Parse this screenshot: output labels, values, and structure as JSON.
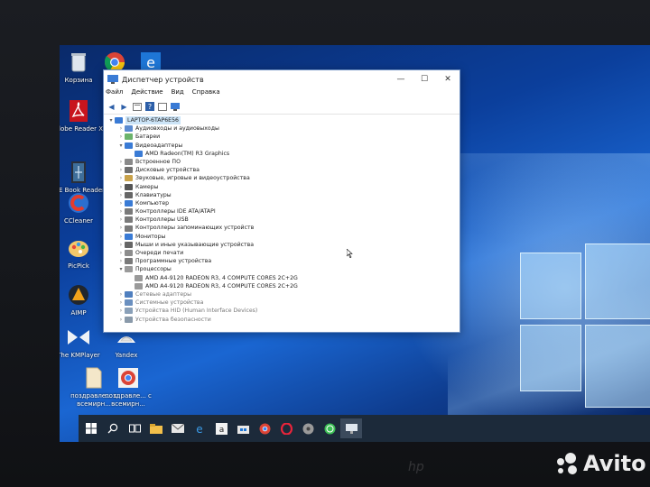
{
  "window": {
    "title": "Диспетчер устройств",
    "controls": [
      "—",
      "☐",
      "✕"
    ],
    "menu": [
      "Файл",
      "Действие",
      "Вид",
      "Справка"
    ]
  },
  "tree": {
    "root": "LAPTOP-6TAP6E56",
    "items": [
      {
        "label": "Аудиовходы и аудиовыходы",
        "expanded": false,
        "indent": 1
      },
      {
        "label": "Батареи",
        "expanded": false,
        "indent": 1
      },
      {
        "label": "Видеоадаптеры",
        "expanded": true,
        "indent": 1
      },
      {
        "label": "AMD Radeon(TM) R3 Graphics",
        "expanded": null,
        "indent": 2
      },
      {
        "label": "Встроенное ПО",
        "expanded": false,
        "indent": 1
      },
      {
        "label": "Дисковые устройства",
        "expanded": false,
        "indent": 1
      },
      {
        "label": "Звуковые, игровые и видеоустройства",
        "expanded": false,
        "indent": 1
      },
      {
        "label": "Камеры",
        "expanded": false,
        "indent": 1
      },
      {
        "label": "Клавиатуры",
        "expanded": false,
        "indent": 1
      },
      {
        "label": "Компьютер",
        "expanded": false,
        "indent": 1
      },
      {
        "label": "Контроллеры IDE ATA/ATAPI",
        "expanded": false,
        "indent": 1
      },
      {
        "label": "Контроллеры USB",
        "expanded": false,
        "indent": 1
      },
      {
        "label": "Контроллеры запоминающих устройств",
        "expanded": false,
        "indent": 1
      },
      {
        "label": "Мониторы",
        "expanded": false,
        "indent": 1
      },
      {
        "label": "Мыши и иные указывающие устройства",
        "expanded": false,
        "indent": 1
      },
      {
        "label": "Очереди печати",
        "expanded": false,
        "indent": 1
      },
      {
        "label": "Программные устройства",
        "expanded": false,
        "indent": 1
      },
      {
        "label": "Процессоры",
        "expanded": true,
        "indent": 1
      },
      {
        "label": "AMD A4-9120 RADEON R3, 4 COMPUTE CORES 2C+2G",
        "expanded": null,
        "indent": 2
      },
      {
        "label": "AMD A4-9120 RADEON R3, 4 COMPUTE CORES 2C+2G",
        "expanded": null,
        "indent": 2
      },
      {
        "label": "Сетевые адаптеры",
        "expanded": false,
        "indent": 1
      },
      {
        "label": "Системные устройства",
        "expanded": false,
        "indent": 1
      },
      {
        "label": "Устройства HID (Human Interface Devices)",
        "expanded": false,
        "indent": 1
      },
      {
        "label": "Устройства безопасности",
        "expanded": false,
        "indent": 1
      }
    ]
  },
  "desktop_icons": [
    {
      "label": "Корзина",
      "icon": "recycle-bin-icon"
    },
    {
      "label": "Adobe Reader XI",
      "icon": "adobe-reader-icon"
    },
    {
      "label": "ICE Book Reader Pr...",
      "icon": "ice-book-reader-icon"
    },
    {
      "label": "CCleaner",
      "icon": "ccleaner-icon"
    },
    {
      "label": "PicPick",
      "icon": "picpick-icon"
    },
    {
      "label": "AIMP",
      "icon": "aimp-icon"
    },
    {
      "label": "The KMPlayer",
      "icon": "kmplayer-icon"
    },
    {
      "label": "Yandex",
      "icon": "yandex-icon"
    },
    {
      "label": "поздравле... с всемирн...",
      "icon": "document-icon"
    },
    {
      "label": "поздравле... с всемирн...",
      "icon": "chrome-shortcut-icon"
    },
    {
      "label": "",
      "icon": "chrome-icon"
    },
    {
      "label": "",
      "icon": "edge-icon"
    }
  ],
  "taskbar": [
    "start-icon",
    "search-icon",
    "task-view-icon",
    "file-explorer-icon",
    "mail-icon",
    "edge-icon",
    "amazon-icon",
    "store-icon",
    "chrome-icon",
    "opera-icon",
    "media-icon",
    "whatsapp-icon",
    "device-manager-icon"
  ],
  "watermark": {
    "brand": "Avito",
    "bezel_logo": "hp"
  },
  "colors": {
    "selection": "#cce4f7",
    "desktop": "#0b3f9c",
    "taskbar": "#1c2a3a"
  }
}
